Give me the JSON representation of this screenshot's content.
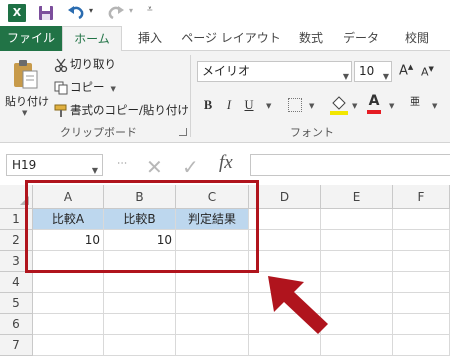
{
  "app": {
    "logo": "X"
  },
  "tabs": [
    "ファイル",
    "ホーム",
    "挿入",
    "ページ レイアウト",
    "数式",
    "データ",
    "校閲"
  ],
  "clipboard": {
    "paste_label": "貼り付け",
    "cut_label": "切り取り",
    "copy_label": "コピー",
    "format_painter_label": "書式のコピー/貼り付け",
    "group_label": "クリップボード"
  },
  "font": {
    "name": "メイリオ",
    "size": "10",
    "grow_label": "A",
    "shrink_label": "A",
    "bold_label": "B",
    "italic_label": "I",
    "underline_label": "U",
    "color_label": "A",
    "phonetic_label": "亜",
    "group_label": "フォント"
  },
  "formula_bar": {
    "name_box": "H19",
    "fx_label": "fx",
    "formula": ""
  },
  "sheet": {
    "columns": [
      "A",
      "B",
      "C",
      "D",
      "E",
      "F"
    ],
    "rows": [
      "1",
      "2",
      "3",
      "4",
      "5",
      "6",
      "7"
    ],
    "cells": {
      "A1": "比較A",
      "B1": "比較B",
      "C1": "判定結果",
      "A2": "10",
      "B2": "10"
    }
  },
  "colors": {
    "brand": "#217346",
    "header_fill": "#bdd7ee",
    "highlight": "#b0141d"
  }
}
